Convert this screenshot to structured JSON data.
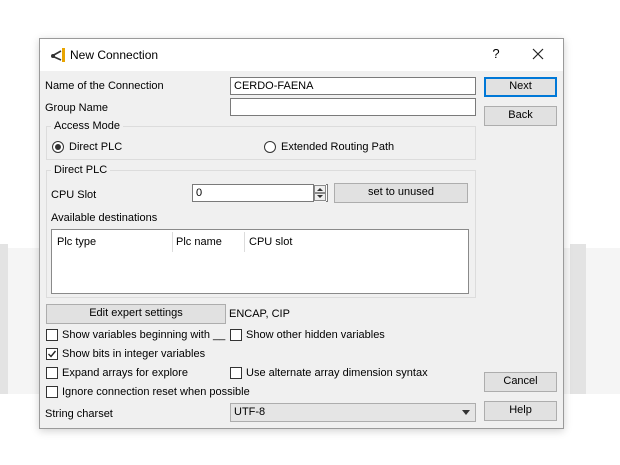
{
  "dialog": {
    "title": "New Connection",
    "help_glyph": "?",
    "close_glyph": "close"
  },
  "form": {
    "connection_name_label": "Name of the Connection",
    "connection_name_value": "CERDO-FAENA",
    "group_name_label": "Group Name",
    "group_name_value": ""
  },
  "access_mode": {
    "title": "Access Mode",
    "direct_plc_label": "Direct PLC",
    "direct_plc_selected": true,
    "extended_routing_label": "Extended Routing Path",
    "extended_routing_selected": false
  },
  "direct_plc": {
    "title": "Direct PLC",
    "cpu_slot_label": "CPU Slot",
    "cpu_slot_value": "0",
    "set_unused_label": "set to unused",
    "available_destinations_label": "Available destinations",
    "columns": [
      "Plc type",
      "Plc name",
      "CPU slot"
    ],
    "rows": []
  },
  "expert": {
    "button_label": "Edit expert settings",
    "summary": "ENCAP, CIP"
  },
  "options": {
    "show_vars_beginning": {
      "label": "Show variables beginning with __",
      "checked": false
    },
    "show_hidden": {
      "label": "Show other hidden variables",
      "checked": false
    },
    "show_bits": {
      "label": "Show bits in integer variables",
      "checked": true
    },
    "expand_arrays": {
      "label": "Expand arrays for explore",
      "checked": false
    },
    "alt_array_syntax": {
      "label": "Use alternate array dimension syntax",
      "checked": false
    },
    "ignore_reset": {
      "label": "Ignore connection reset when possible",
      "checked": false
    }
  },
  "charset": {
    "label": "String charset",
    "selected": "UTF-8"
  },
  "buttons": {
    "next": "Next",
    "back": "Back",
    "cancel": "Cancel",
    "help": "Help"
  },
  "colors": {
    "dialog_bg": "#f0f0f0",
    "accent": "#0078d7",
    "button_bg": "#e1e1e1"
  }
}
